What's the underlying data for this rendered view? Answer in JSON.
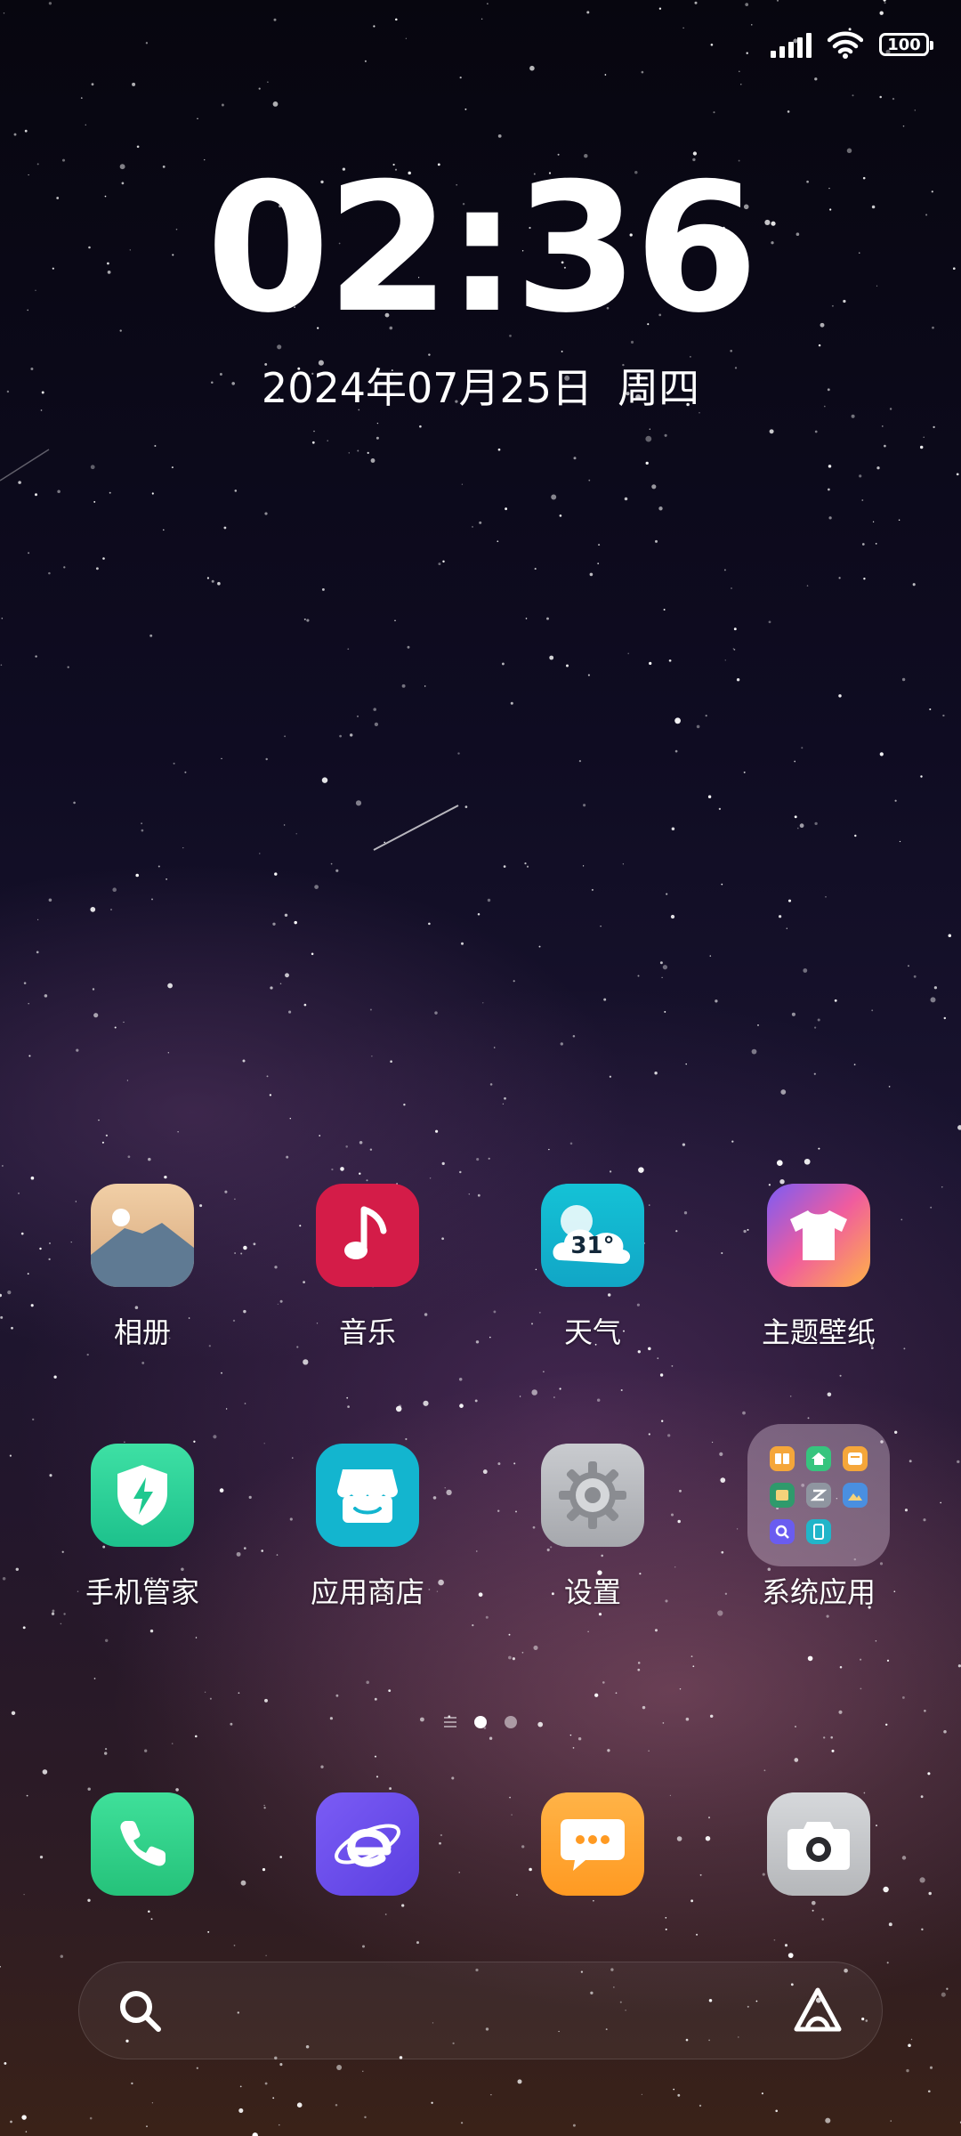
{
  "status_bar": {
    "battery": "100",
    "icons": [
      "signal-icon",
      "wifi-icon",
      "battery-icon"
    ]
  },
  "clock": {
    "time": "02:36",
    "date": "2024年07月25日",
    "weekday": "周四"
  },
  "apps": [
    {
      "label": "相册",
      "icon": "photos-icon",
      "color": "#d9b48c"
    },
    {
      "label": "音乐",
      "icon": "music-note-icon",
      "color": "#d41c48"
    },
    {
      "label": "天气",
      "icon": "weather-icon",
      "color": "#15b6d0",
      "temp": "31°"
    },
    {
      "label": "主题壁纸",
      "icon": "tshirt-icon",
      "color": "#f46a6a"
    },
    {
      "label": "手机管家",
      "icon": "security-shield-icon",
      "color": "#2ed39a"
    },
    {
      "label": "应用商店",
      "icon": "store-icon",
      "color": "#13b5cf"
    },
    {
      "label": "设置",
      "icon": "gear-icon",
      "color": "#b7b9bd"
    },
    {
      "label": "系统应用",
      "icon": "folder-icon",
      "color": "#c9b6c8"
    }
  ],
  "dock": [
    {
      "icon": "phone-icon",
      "color": "#34d388"
    },
    {
      "icon": "browser-icon",
      "color": "#6a4cf0"
    },
    {
      "icon": "messages-icon",
      "color": "#ffa633"
    },
    {
      "icon": "camera-icon",
      "color": "#c4c6c9"
    }
  ],
  "search": {
    "icons": [
      "search-icon",
      "assistant-icon"
    ]
  },
  "pages": {
    "count": 2,
    "current": 1
  }
}
